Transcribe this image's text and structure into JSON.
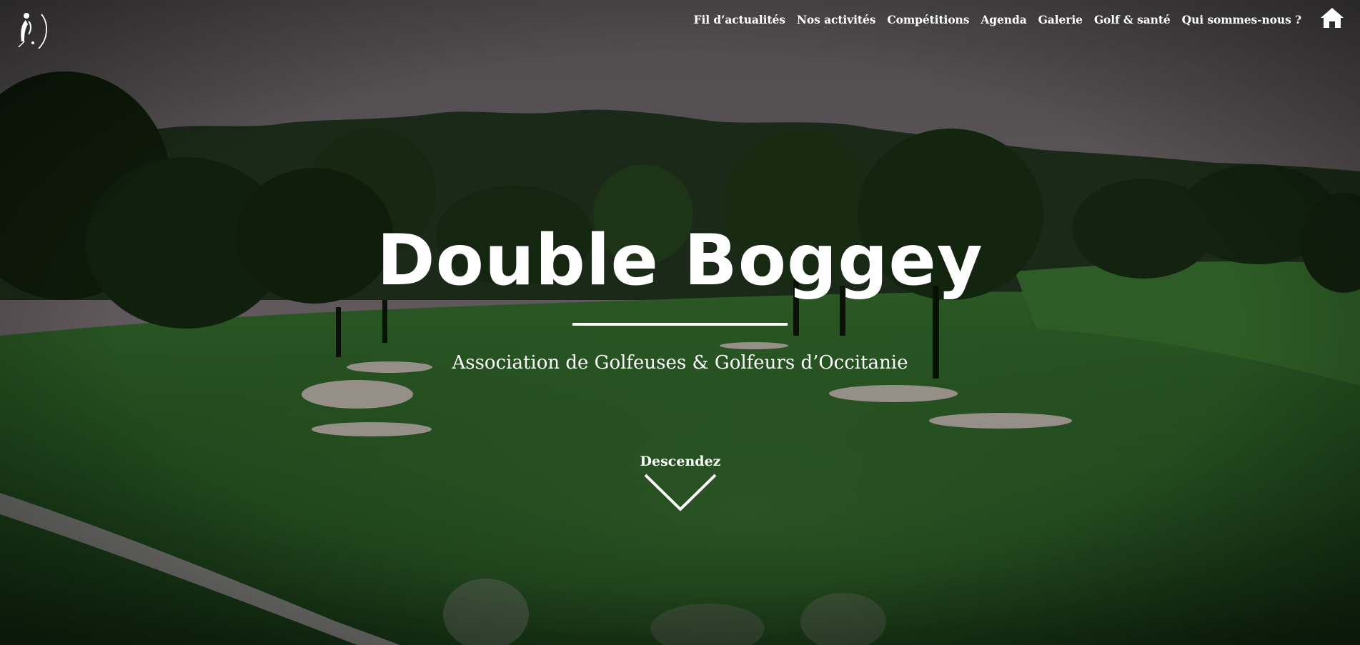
{
  "header": {
    "logo_icon": "golfer-logo-icon",
    "nav": [
      {
        "label": "Fil d’actualités"
      },
      {
        "label": "Nos activités"
      },
      {
        "label": "Compétitions"
      },
      {
        "label": "Agenda"
      },
      {
        "label": "Galerie"
      },
      {
        "label": "Golf & santé"
      },
      {
        "label": "Qui sommes-nous ?"
      }
    ],
    "home_icon": "home-icon"
  },
  "hero": {
    "title": "Double Boggey",
    "subtitle": "Association de Golfeuses & Golfeurs d’Occitanie",
    "scroll_label": "Descendez",
    "scroll_icon": "chevron-down-icon"
  },
  "colors": {
    "text": "#ffffff",
    "fairway": "#2f6a2c",
    "sky": "#8a8185",
    "trees": "#1c3417"
  }
}
